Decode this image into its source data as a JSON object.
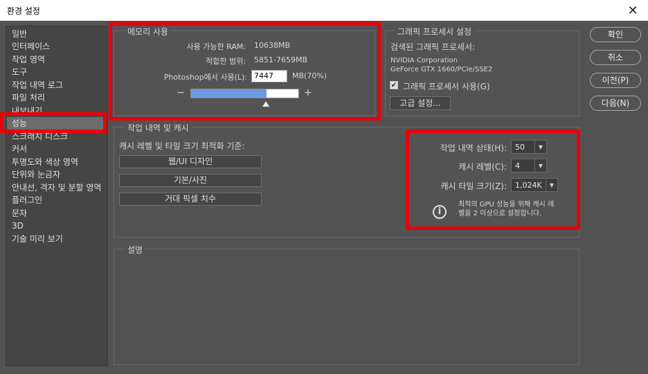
{
  "window": {
    "title": "환경 설정",
    "close": "✕"
  },
  "sidebar": {
    "items": [
      {
        "label": "일반"
      },
      {
        "label": "인터페이스"
      },
      {
        "label": "작업 영역"
      },
      {
        "label": "도구"
      },
      {
        "label": "작업 내역 로그"
      },
      {
        "label": "파일 처리"
      },
      {
        "label": "내보내기"
      },
      {
        "label": "성능",
        "selected": true
      },
      {
        "label": "스크래치 디스크"
      },
      {
        "label": "커서"
      },
      {
        "label": "투명도와 색상 영역"
      },
      {
        "label": "단위와 눈금자"
      },
      {
        "label": "안내선, 격자 및 분할 영역"
      },
      {
        "label": "플러그인"
      },
      {
        "label": "문자"
      },
      {
        "label": "3D"
      },
      {
        "label": "기술 미리 보기"
      }
    ]
  },
  "memory": {
    "title": "메모리 사용",
    "available_label": "사용 가능한 RAM:",
    "available_value": "10638MB",
    "ideal_label": "적합한 범위:",
    "ideal_value": "5851-7659MB",
    "use_label": "Photoshop에서 사용(L):",
    "use_value": "7447",
    "use_unit": "MB(70%)",
    "minus": "−",
    "plus": "+",
    "slider_fraction": 0.7
  },
  "gpu": {
    "title": "그래픽 프로세서 설정",
    "detected_label": "검색된 그래픽 프로세서:",
    "gpu_vendor": "NVIDIA Corporation",
    "gpu_model": "GeForce GTX 1660/PCIe/SSE2",
    "use_gpu_label": "그래픽 프로세서 사용(G)",
    "use_gpu_checked": "✔",
    "advanced_button": "고급 설정..."
  },
  "history_cache": {
    "title": "작업 내역 및 캐시",
    "optimize_label": "캐시 레벨 및 타일 크기 최적화 기준:",
    "presets": [
      "웹/UI 디자인",
      "기본/사진",
      "거대 픽셀 치수"
    ],
    "history_states_label": "작업 내역 상태(H):",
    "history_states_value": "50",
    "cache_levels_label": "캐시 레벨(C):",
    "cache_levels_value": "4",
    "cache_tile_label": "캐시 타일 크기(Z):",
    "cache_tile_value": "1,024K",
    "info_line1": "최적의 GPU 성능을 위해 캐시 레",
    "info_line2": "벨을 2 이상으로 설정합니다."
  },
  "description": {
    "title": "설명"
  },
  "buttons": {
    "ok": "확인",
    "cancel": "취소",
    "prev": "이전(P)",
    "next": "다음(N)"
  },
  "colors": {
    "highlight": "#e8000a",
    "slider_fill": "#6a9ae2"
  }
}
